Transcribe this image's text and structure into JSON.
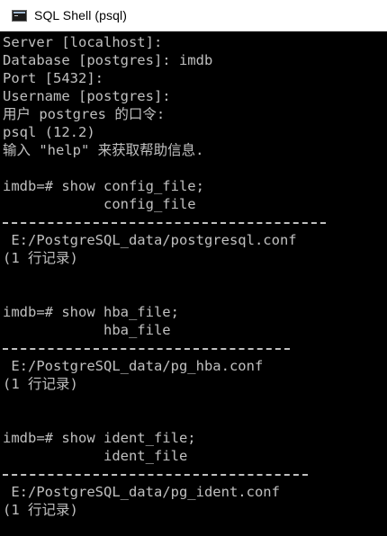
{
  "window": {
    "title": "SQL Shell (psql)",
    "icon": "console-icon"
  },
  "console": {
    "lines": [
      {
        "kind": "text",
        "text": "Server [localhost]:"
      },
      {
        "kind": "text",
        "text": "Database [postgres]: imdb"
      },
      {
        "kind": "text",
        "text": "Port [5432]:"
      },
      {
        "kind": "text",
        "text": "Username [postgres]:"
      },
      {
        "kind": "text",
        "text": "用户 postgres 的口令:"
      },
      {
        "kind": "text",
        "text": "psql (12.2)"
      },
      {
        "kind": "text",
        "text": "输入 \"help\" 来获取帮助信息."
      },
      {
        "kind": "blank",
        "text": ""
      },
      {
        "kind": "prompt",
        "text": "imdb=# show config_file;"
      },
      {
        "kind": "header",
        "text": "            config_file"
      },
      {
        "kind": "rule",
        "text": "------------------------------------"
      },
      {
        "kind": "value",
        "text": " E:/PostgreSQL_data/postgresql.conf"
      },
      {
        "kind": "count",
        "text": "(1 行记录)"
      },
      {
        "kind": "blank",
        "text": ""
      },
      {
        "kind": "blank",
        "text": ""
      },
      {
        "kind": "prompt",
        "text": "imdb=# show hba_file;"
      },
      {
        "kind": "header",
        "text": "            hba_file"
      },
      {
        "kind": "rule",
        "text": "--------------------------------"
      },
      {
        "kind": "value",
        "text": " E:/PostgreSQL_data/pg_hba.conf"
      },
      {
        "kind": "count",
        "text": "(1 行记录)"
      },
      {
        "kind": "blank",
        "text": ""
      },
      {
        "kind": "blank",
        "text": ""
      },
      {
        "kind": "prompt",
        "text": "imdb=# show ident_file;"
      },
      {
        "kind": "header",
        "text": "            ident_file"
      },
      {
        "kind": "rule",
        "text": "----------------------------------"
      },
      {
        "kind": "value",
        "text": " E:/PostgreSQL_data/pg_ident.conf"
      },
      {
        "kind": "count",
        "text": "(1 行记录)"
      }
    ]
  },
  "colors": {
    "console_background": "#000000",
    "console_text": "#c0c0c0",
    "titlebar_background": "#ffffff"
  }
}
